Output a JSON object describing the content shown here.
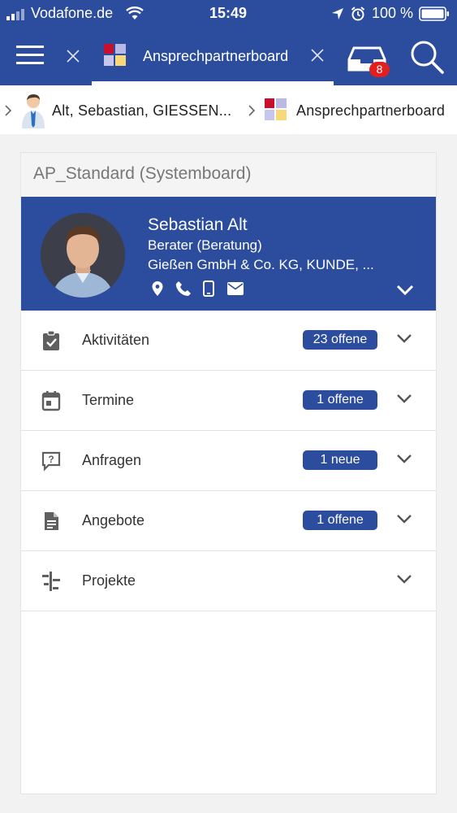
{
  "status_bar": {
    "carrier": "Vodafone.de",
    "time": "15:49",
    "battery": "100 %"
  },
  "nav": {
    "tab_title": "Ansprechpartnerboard",
    "inbox_count": "8"
  },
  "breadcrumb": {
    "person": "Alt, Sebastian, GIESSEN...",
    "board": "Ansprechpartnerboard"
  },
  "board": {
    "title": "AP_Standard (Systemboard)"
  },
  "contact": {
    "name": "Sebastian Alt",
    "role": "Berater (Beratung)",
    "company": "Gießen GmbH & Co. KG, KUNDE, ..."
  },
  "sections": [
    {
      "label": "Aktivitäten",
      "badge": "23 offene",
      "icon": "clipboard-check-icon"
    },
    {
      "label": "Termine",
      "badge": "1 offene",
      "icon": "calendar-icon"
    },
    {
      "label": "Anfragen",
      "badge": "1 neue",
      "icon": "question-bubble-icon"
    },
    {
      "label": "Angebote",
      "badge": "1 offene",
      "icon": "document-icon"
    },
    {
      "label": "Projekte",
      "badge": "",
      "icon": "project-timeline-icon"
    }
  ],
  "colors": {
    "brand": "#2c4c9e",
    "notification": "#e02020"
  }
}
